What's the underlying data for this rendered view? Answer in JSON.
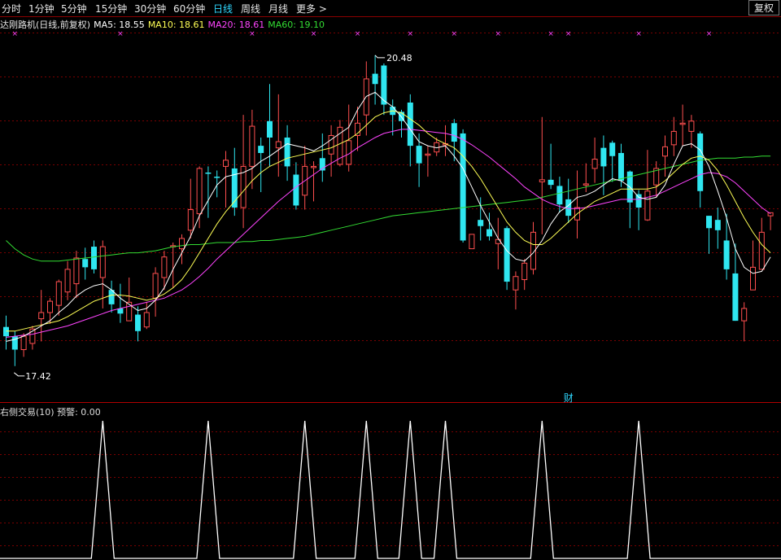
{
  "toolbar": {
    "tabs": [
      {
        "label": "分时",
        "active": false
      },
      {
        "label": "1分钟",
        "active": false
      },
      {
        "label": "5分钟",
        "active": false
      },
      {
        "label": "15分钟",
        "active": false
      },
      {
        "label": "30分钟",
        "active": false
      },
      {
        "label": "60分钟",
        "active": false
      },
      {
        "label": "日线",
        "active": true
      },
      {
        "label": "周线",
        "active": false
      },
      {
        "label": "月线",
        "active": false
      },
      {
        "label": "更多 >",
        "active": false
      }
    ],
    "adjust_button": "复权"
  },
  "legend": {
    "title": "达刚路机(日线,前复权)",
    "ma5": "MA5: 18.55",
    "ma10": "MA10: 18.61",
    "ma20": "MA20: 18.61",
    "ma60": "MA60: 19.10"
  },
  "annotations": {
    "high_label": "20.48",
    "low_label": "17.42",
    "event_marker": "财"
  },
  "indicator": {
    "legend": "右侧交易(10) 预警: 0.00"
  },
  "colors": {
    "up": "#ff4f4f",
    "down": "#2fe6f0",
    "ma5": "#ffffff",
    "ma10": "#ffff55",
    "ma20": "#ff44ff",
    "ma60": "#33dd33",
    "x_marker": "#ff44ff",
    "indicator_line": "#ffffff",
    "grid": "#7a0000"
  },
  "chart_data": {
    "type": "candlestick",
    "title": "达刚路机(日线,前复权)",
    "price_range": [
      17.3,
      20.7
    ],
    "candles": [
      [
        17.84,
        17.75,
        17.95,
        17.62
      ],
      [
        17.75,
        17.62,
        17.8,
        17.46
      ],
      [
        17.62,
        17.75,
        17.78,
        17.55
      ],
      [
        17.68,
        17.82,
        17.85,
        17.62
      ],
      [
        17.92,
        17.98,
        18.2,
        17.7
      ],
      [
        17.98,
        18.09,
        18.12,
        17.87
      ],
      [
        18.05,
        18.28,
        18.3,
        17.95
      ],
      [
        18.18,
        18.4,
        18.48,
        18.1
      ],
      [
        18.26,
        18.51,
        18.58,
        18.12
      ],
      [
        18.5,
        18.42,
        18.61,
        18.3
      ],
      [
        18.62,
        18.4,
        18.68,
        18.36
      ],
      [
        18.32,
        18.62,
        18.68,
        18.02
      ],
      [
        18.2,
        18.06,
        18.29,
        17.98
      ],
      [
        18.02,
        17.97,
        18.26,
        17.88
      ],
      [
        17.9,
        18.08,
        18.32,
        17.9
      ],
      [
        17.96,
        17.8,
        18.04,
        17.7
      ],
      [
        17.84,
        17.98,
        18.08,
        17.82
      ],
      [
        18.12,
        18.36,
        18.42,
        17.94
      ],
      [
        18.32,
        18.52,
        18.58,
        18.2
      ],
      [
        18.62,
        18.63,
        18.66,
        18.22
      ],
      [
        18.6,
        18.7,
        18.74,
        18.45
      ],
      [
        18.78,
        18.98,
        19.28,
        18.7
      ],
      [
        18.94,
        19.38,
        19.4,
        18.8
      ],
      [
        19.34,
        19.33,
        19.4,
        18.9
      ],
      [
        19.3,
        19.29,
        19.36,
        19.1
      ],
      [
        19.4,
        19.46,
        19.55,
        19.0
      ],
      [
        19.38,
        19.0,
        19.58,
        18.92
      ],
      [
        19.0,
        19.4,
        19.9,
        18.8
      ],
      [
        19.4,
        19.79,
        19.95,
        19.18
      ],
      [
        19.6,
        19.53,
        19.68,
        19.15
      ],
      [
        19.84,
        19.68,
        20.2,
        19.4
      ],
      [
        19.58,
        19.64,
        20.1,
        19.3
      ],
      [
        19.68,
        19.4,
        19.8,
        19.26
      ],
      [
        19.32,
        19.02,
        19.44,
        18.98
      ],
      [
        19.12,
        19.4,
        19.6,
        18.98
      ],
      [
        19.4,
        19.4,
        19.45,
        19.06
      ],
      [
        19.48,
        19.36,
        19.72,
        19.25
      ],
      [
        19.52,
        19.7,
        19.8,
        19.3
      ],
      [
        19.42,
        19.78,
        19.85,
        19.4
      ],
      [
        19.42,
        19.65,
        20.0,
        19.35
      ],
      [
        19.7,
        19.82,
        19.98,
        19.55
      ],
      [
        19.9,
        20.25,
        20.42,
        19.7
      ],
      [
        20.3,
        20.2,
        20.48,
        20.0
      ],
      [
        20.38,
        20.0,
        20.4,
        19.9
      ],
      [
        19.98,
        19.9,
        20.05,
        19.7
      ],
      [
        19.93,
        19.84,
        19.95,
        19.68
      ],
      [
        20.02,
        19.6,
        20.1,
        19.4
      ],
      [
        19.6,
        19.43,
        19.72,
        19.2
      ],
      [
        19.52,
        19.52,
        19.6,
        19.3
      ],
      [
        19.54,
        19.63,
        19.68,
        19.5
      ],
      [
        19.62,
        19.62,
        19.8,
        19.5
      ],
      [
        19.82,
        19.64,
        19.86,
        19.45
      ],
      [
        19.72,
        18.68,
        19.76,
        18.66
      ],
      [
        18.6,
        18.74,
        18.74,
        18.62
      ],
      [
        18.88,
        18.82,
        19.1,
        18.68
      ],
      [
        18.79,
        18.72,
        18.95,
        18.68
      ],
      [
        18.65,
        18.69,
        18.9,
        18.4
      ],
      [
        18.8,
        18.28,
        18.82,
        18.2
      ],
      [
        18.2,
        18.33,
        18.38,
        18.01
      ],
      [
        18.3,
        18.46,
        18.5,
        18.2
      ],
      [
        18.4,
        18.76,
        18.86,
        18.35
      ],
      [
        19.25,
        19.27,
        19.88,
        18.74
      ],
      [
        19.27,
        19.22,
        19.62,
        19.18
      ],
      [
        19.21,
        19.03,
        19.3,
        18.95
      ],
      [
        19.08,
        18.92,
        19.28,
        18.85
      ],
      [
        18.88,
        19.0,
        19.36,
        18.7
      ],
      [
        19.22,
        19.23,
        19.43,
        19.15
      ],
      [
        19.38,
        19.47,
        19.68,
        19.24
      ],
      [
        19.58,
        19.4,
        19.7,
        19.12
      ],
      [
        19.63,
        19.5,
        19.65,
        19.25
      ],
      [
        19.53,
        19.26,
        19.62,
        19.2
      ],
      [
        19.35,
        19.05,
        19.36,
        18.8
      ],
      [
        19.13,
        19.0,
        19.17,
        18.78
      ],
      [
        18.88,
        19.16,
        19.56,
        18.87
      ],
      [
        19.22,
        19.38,
        19.45,
        19.1
      ],
      [
        19.5,
        19.59,
        19.7,
        19.3
      ],
      [
        19.61,
        19.74,
        19.88,
        19.5
      ],
      [
        19.82,
        19.82,
        20.0,
        19.6
      ],
      [
        19.74,
        19.84,
        19.9,
        19.58
      ],
      [
        19.72,
        19.16,
        19.74,
        19.0
      ],
      [
        18.92,
        18.8,
        18.92,
        18.55
      ],
      [
        18.88,
        18.78,
        19.0,
        18.6
      ],
      [
        18.68,
        18.4,
        18.94,
        18.3
      ],
      [
        18.36,
        17.9,
        18.65,
        17.9
      ],
      [
        17.9,
        18.02,
        18.08,
        17.7
      ],
      [
        18.2,
        18.42,
        18.68,
        18.2
      ],
      [
        18.4,
        18.76,
        18.9,
        18.4
      ],
      [
        18.92,
        18.95,
        18.95,
        18.78
      ]
    ],
    "ma5": [
      17.7,
      17.72,
      17.75,
      17.8,
      17.85,
      17.9,
      17.98,
      18.05,
      18.14,
      18.2,
      18.24,
      18.26,
      18.2,
      18.12,
      18.06,
      18.0,
      18.02,
      18.1,
      18.22,
      18.4,
      18.56,
      18.72,
      18.92,
      19.07,
      19.22,
      19.3,
      19.32,
      19.34,
      19.38,
      19.45,
      19.5,
      19.56,
      19.62,
      19.6,
      19.58,
      19.55,
      19.6,
      19.66,
      19.72,
      19.78,
      19.95,
      20.08,
      20.12,
      20.04,
      19.98,
      19.88,
      19.76,
      19.64,
      19.6,
      19.58,
      19.6,
      19.5,
      19.38,
      19.2,
      19.02,
      18.86,
      18.7,
      18.58,
      18.5,
      18.48,
      18.56,
      18.68,
      18.84,
      18.96,
      19.02,
      19.1,
      19.12,
      19.16,
      19.22,
      19.28,
      19.26,
      19.2,
      19.1,
      19.08,
      19.1,
      19.22,
      19.42,
      19.6,
      19.62,
      19.56,
      19.4,
      19.16,
      18.9,
      18.6,
      18.42,
      18.36,
      18.38,
      18.52
    ],
    "ma10": [
      17.8,
      17.8,
      17.82,
      17.84,
      17.86,
      17.88,
      17.9,
      17.94,
      17.99,
      18.04,
      18.09,
      18.12,
      18.15,
      18.15,
      18.14,
      18.12,
      18.1,
      18.12,
      18.16,
      18.22,
      18.3,
      18.42,
      18.56,
      18.7,
      18.84,
      18.96,
      19.06,
      19.16,
      19.26,
      19.34,
      19.4,
      19.44,
      19.48,
      19.5,
      19.52,
      19.54,
      19.56,
      19.58,
      19.62,
      19.66,
      19.72,
      19.8,
      19.88,
      19.92,
      19.94,
      19.92,
      19.86,
      19.8,
      19.72,
      19.66,
      19.62,
      19.58,
      19.5,
      19.4,
      19.28,
      19.14,
      19.0,
      18.86,
      18.76,
      18.68,
      18.64,
      18.64,
      18.7,
      18.78,
      18.86,
      18.94,
      19.0,
      19.06,
      19.1,
      19.14,
      19.18,
      19.18,
      19.18,
      19.18,
      19.2,
      19.26,
      19.34,
      19.42,
      19.48,
      19.5,
      19.46,
      19.36,
      19.22,
      19.06,
      18.9,
      18.76,
      18.64,
      18.56
    ],
    "ma20": [
      17.74,
      17.75,
      17.76,
      17.77,
      17.79,
      17.81,
      17.83,
      17.85,
      17.88,
      17.91,
      17.94,
      17.97,
      18.0,
      18.02,
      18.04,
      18.06,
      18.08,
      18.1,
      18.12,
      18.16,
      18.2,
      18.26,
      18.33,
      18.41,
      18.5,
      18.58,
      18.66,
      18.74,
      18.82,
      18.9,
      18.98,
      19.06,
      19.13,
      19.2,
      19.26,
      19.32,
      19.38,
      19.43,
      19.48,
      19.52,
      19.58,
      19.63,
      19.68,
      19.72,
      19.74,
      19.76,
      19.76,
      19.75,
      19.74,
      19.73,
      19.72,
      19.7,
      19.66,
      19.61,
      19.55,
      19.49,
      19.42,
      19.35,
      19.28,
      19.2,
      19.14,
      19.08,
      19.04,
      19.01,
      18.99,
      18.99,
      19.0,
      19.02,
      19.04,
      19.06,
      19.08,
      19.08,
      19.08,
      19.1,
      19.12,
      19.16,
      19.2,
      19.24,
      19.28,
      19.32,
      19.34,
      19.33,
      19.3,
      19.24,
      19.16,
      19.08,
      19.0,
      18.94
    ],
    "ma60": [
      18.68,
      18.6,
      18.54,
      18.5,
      18.48,
      18.48,
      18.48,
      18.49,
      18.5,
      18.51,
      18.52,
      18.53,
      18.54,
      18.55,
      18.56,
      18.56,
      18.57,
      18.58,
      18.6,
      18.62,
      18.63,
      18.64,
      18.64,
      18.65,
      18.66,
      18.66,
      18.66,
      18.67,
      18.67,
      18.68,
      18.68,
      18.69,
      18.7,
      18.71,
      18.72,
      18.74,
      18.76,
      18.78,
      18.8,
      18.82,
      18.84,
      18.86,
      18.88,
      18.9,
      18.92,
      18.93,
      18.94,
      18.95,
      18.96,
      18.97,
      18.98,
      18.99,
      19.0,
      19.01,
      19.02,
      19.03,
      19.04,
      19.05,
      19.06,
      19.07,
      19.08,
      19.1,
      19.12,
      19.14,
      19.16,
      19.18,
      19.2,
      19.22,
      19.24,
      19.26,
      19.28,
      19.3,
      19.32,
      19.34,
      19.36,
      19.38,
      19.4,
      19.42,
      19.44,
      19.46,
      19.47,
      19.48,
      19.48,
      19.48,
      19.49,
      19.49,
      19.5,
      19.5
    ],
    "x_markers": [
      1,
      13,
      28,
      35,
      40,
      46,
      51,
      56,
      62,
      64,
      72,
      80,
      89
    ],
    "high": {
      "index": 42,
      "value": 20.48
    },
    "low": {
      "index": 1,
      "value": 17.42
    },
    "event_index": 64,
    "indicator": {
      "name": "右侧交易(10)",
      "range": [
        0,
        1
      ],
      "signals": [
        11,
        23,
        34,
        41,
        46,
        50,
        61,
        72
      ]
    }
  }
}
